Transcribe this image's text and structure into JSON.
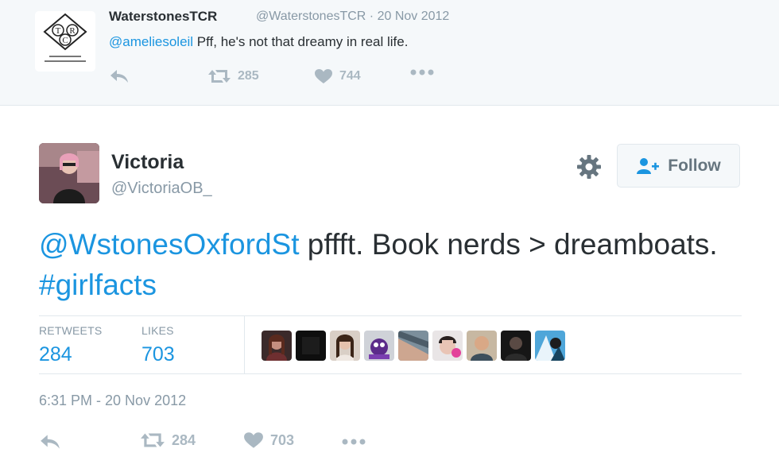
{
  "parent_tweet": {
    "avatar_letters": [
      "T",
      "C",
      "R"
    ],
    "avatar_caption": "Waterstones Tottenham Court Road",
    "display_name": "WaterstonesTCR",
    "handle": "@WaterstonesTCR",
    "separator": "·",
    "date": "20 Nov 2012",
    "mention": "@ameliesoleil",
    "text": " Pff, he's not that dreamy in real life.",
    "actions": {
      "reply_icon": "reply-icon",
      "retweet_icon": "retweet-icon",
      "retweet_count": "285",
      "like_icon": "heart-icon",
      "like_count": "744",
      "more_icon": "more-icon"
    }
  },
  "main_tweet": {
    "display_name": "Victoria",
    "handle": "@VictoriaOB_",
    "settings_icon": "gear-icon",
    "follow_label": "Follow",
    "text_mention": "@WstonesOxfordSt",
    "text_body": " pffft. Book nerds > dreamboats. ",
    "text_hashtag": "#girlfacts",
    "stats": {
      "retweets_label": "RETWEETS",
      "retweets_value": "284",
      "likes_label": "LIKES",
      "likes_value": "703"
    },
    "timestamp": "6:31 PM - 20 Nov 2012",
    "actions": {
      "retweet_count": "284",
      "like_count": "703"
    }
  },
  "colors": {
    "link": "#1b95e0",
    "muted": "#8899a6",
    "icon": "#aab8c2",
    "parent_bg": "#f5f8fa"
  }
}
